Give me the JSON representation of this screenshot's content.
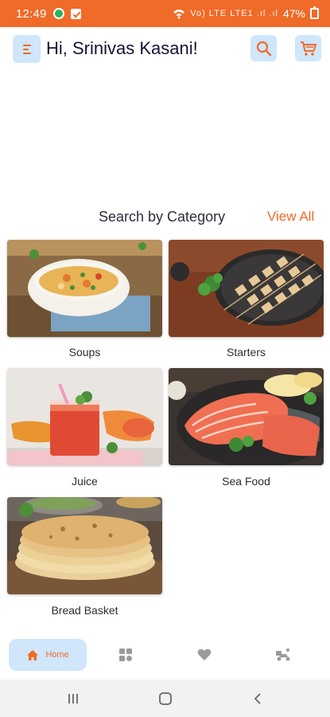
{
  "status_bar": {
    "time": "12:49",
    "network": "Vo) LTE LTE1 .ıl .ıl",
    "battery": "47%"
  },
  "header": {
    "greeting": "Hi, Srinivas Kasani!",
    "icons": [
      "menu-icon",
      "search-icon",
      "cart-icon"
    ]
  },
  "categories_section": {
    "title": "Search by Category",
    "view_all": "View All",
    "items": [
      {
        "label": "Soups"
      },
      {
        "label": "Starters"
      },
      {
        "label": "Juice"
      },
      {
        "label": "Sea Food"
      },
      {
        "label": "Bread Basket"
      }
    ]
  },
  "bottom_nav": {
    "home_label": "Home",
    "items": [
      "home-icon",
      "categories-icon",
      "favorites-icon",
      "delivery-icon"
    ]
  },
  "colors": {
    "accent": "#f06a28",
    "button_bg": "#cfe6fb",
    "status_bar": "#f06a28"
  }
}
